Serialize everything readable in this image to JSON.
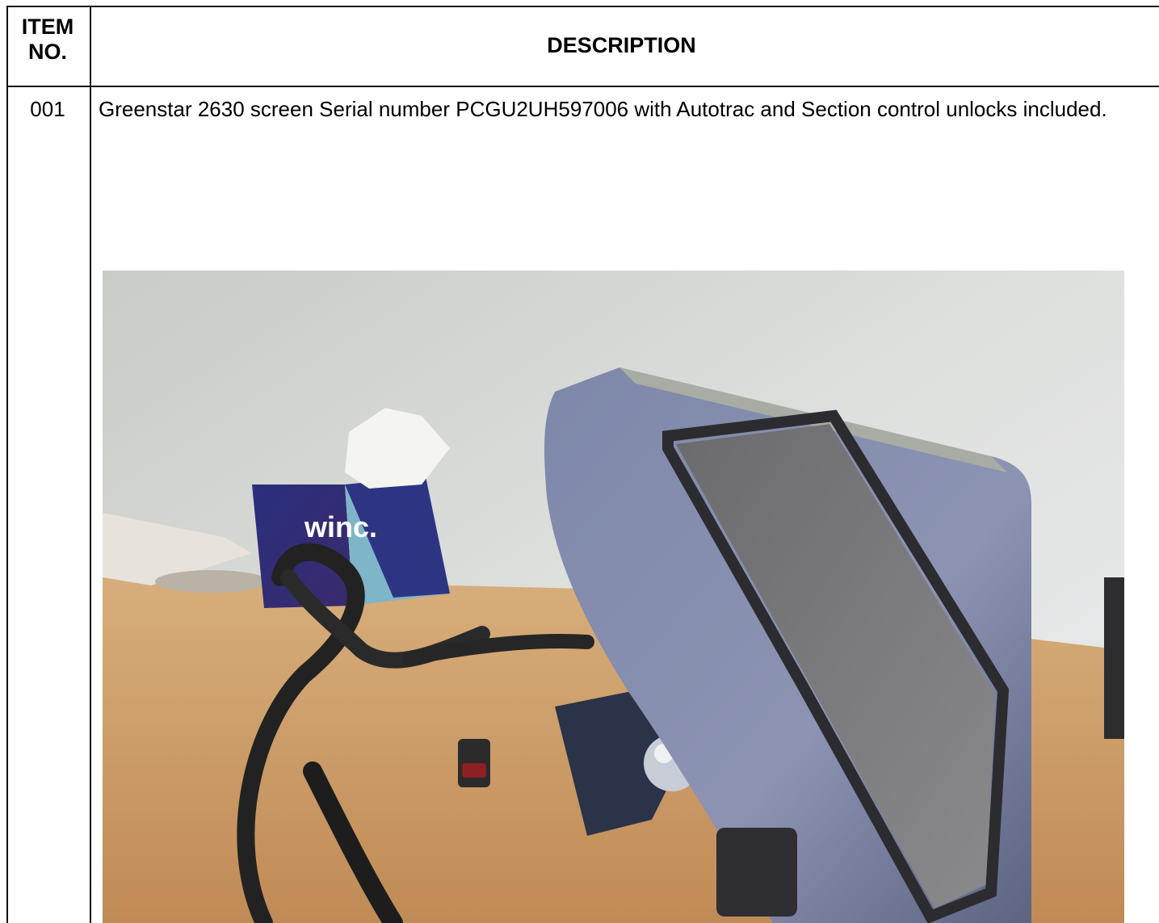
{
  "table": {
    "header": {
      "item_no_line1": "ITEM",
      "item_no_line2": "NO.",
      "description": "DESCRIPTION"
    },
    "rows": [
      {
        "item_no": "001",
        "description": "Greenstar 2630 screen Serial number PCGU2UH597006 with Autotrac and Section control unlocks included.",
        "photo": {
          "box_brand_text": "winc."
        }
      }
    ]
  }
}
